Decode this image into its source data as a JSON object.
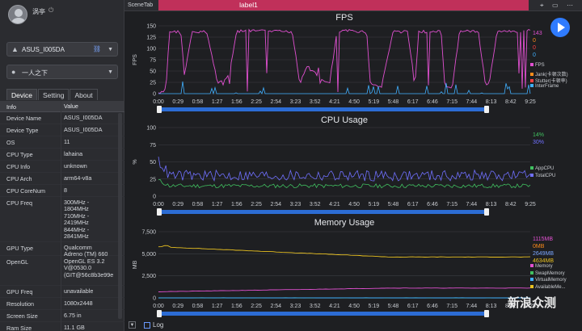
{
  "user": {
    "name": "涡亭"
  },
  "device_select": {
    "label": "ASUS_I005DA"
  },
  "app_select": {
    "label": "一人之下"
  },
  "tabs": [
    "Device",
    "Setting",
    "About"
  ],
  "table": {
    "headers": [
      "Info",
      "Value"
    ],
    "rows": [
      [
        "Device Name",
        "ASUS_I005DA"
      ],
      [
        "Device Type",
        "ASUS_I005DA"
      ],
      [
        "OS",
        "11"
      ],
      [
        "CPU Type",
        "lahaina"
      ],
      [
        "CPU Info",
        "unknown"
      ],
      [
        "CPU Arch",
        "arm64-v8a"
      ],
      [
        "CPU CoreNum",
        "8"
      ],
      [
        "CPU Freq",
        "300MHz -\n1804MHz\n710MHz -\n2419MHz\n844MHz -\n2841MHz"
      ],
      [
        "GPU Type",
        "Qualcomm\nAdreno (TM) 660"
      ],
      [
        "OpenGL",
        "OpenGL ES 3.2\nV@0530.0\n(GIT@56c8b3e99e"
      ],
      [
        "GPU Freq",
        "unavailable"
      ],
      [
        "Resolution",
        "1080x2448"
      ],
      [
        "Screen Size",
        "6.75 in"
      ],
      [
        "Ram Size",
        "11.1 GB"
      ]
    ]
  },
  "topbar": {
    "scene_tab": "SceneTab",
    "label": "label1"
  },
  "bottombar": {
    "log_label": "Log"
  },
  "watermark": "新浪众测",
  "xticks": [
    "0:00",
    "0:29",
    "0:58",
    "1:27",
    "1:56",
    "2:25",
    "2:54",
    "3:23",
    "3:52",
    "4:21",
    "4:50",
    "5:19",
    "5:48",
    "6:17",
    "6:46",
    "7:15",
    "7:44",
    "8:13",
    "8:42",
    "9:25"
  ],
  "chart_data": [
    {
      "type": "line",
      "title": "FPS",
      "ylabel": "FPS",
      "ylim": [
        0,
        150
      ],
      "yticks": [
        "150",
        "125",
        "100",
        "75",
        "50",
        "25",
        "0"
      ],
      "current_values": [
        {
          "text": "143",
          "color": "#e050d0"
        },
        {
          "text": "0",
          "color": "#ff8c1a"
        },
        {
          "text": "0",
          "color": "#ff4040"
        },
        {
          "text": "0",
          "color": "#40b0ff"
        }
      ],
      "series": [
        {
          "name": "FPS",
          "color": "#e050d0"
        },
        {
          "name": "Jank(卡顿次数)",
          "color": "#ff8c1a"
        },
        {
          "name": "Stutter(卡顿率)",
          "color": "#ff4040"
        },
        {
          "name": "InterFrame",
          "color": "#40b0ff"
        }
      ],
      "fps_profile": [
        [
          0,
          2
        ],
        [
          0.02,
          10
        ],
        [
          0.03,
          140
        ],
        [
          0.06,
          140
        ],
        [
          0.07,
          40
        ],
        [
          0.09,
          138
        ],
        [
          0.13,
          140
        ],
        [
          0.16,
          20
        ],
        [
          0.19,
          40
        ],
        [
          0.21,
          140
        ],
        [
          0.23,
          142
        ],
        [
          0.36,
          140
        ],
        [
          0.38,
          20
        ],
        [
          0.4,
          60
        ],
        [
          0.43,
          40
        ],
        [
          0.46,
          20
        ],
        [
          0.48,
          140
        ],
        [
          0.51,
          142
        ],
        [
          0.56,
          140
        ],
        [
          0.57,
          20
        ],
        [
          0.6,
          15
        ],
        [
          0.63,
          140
        ],
        [
          0.67,
          140
        ],
        [
          0.69,
          20
        ],
        [
          0.7,
          140
        ],
        [
          0.76,
          140
        ],
        [
          0.77,
          20
        ],
        [
          0.79,
          15
        ],
        [
          0.81,
          142
        ],
        [
          0.86,
          140
        ],
        [
          0.88,
          20
        ],
        [
          0.89,
          20
        ],
        [
          0.91,
          140
        ],
        [
          0.96,
          140
        ],
        [
          1,
          143
        ]
      ]
    },
    {
      "type": "line",
      "title": "CPU Usage",
      "ylabel": "%",
      "ylim": [
        0,
        100
      ],
      "yticks": [
        "100",
        "75",
        "50",
        "25",
        "0"
      ],
      "current_values": [
        {
          "text": "14%",
          "color": "#40c060"
        },
        {
          "text": "30%",
          "color": "#7070ff"
        }
      ],
      "series": [
        {
          "name": "AppCPU",
          "color": "#40c060",
          "base": 15
        },
        {
          "name": "TotalCPU",
          "color": "#7070ff",
          "base": 30
        }
      ]
    },
    {
      "type": "line",
      "title": "Memory Usage",
      "ylabel": "MB",
      "ylim": [
        0,
        7500
      ],
      "yticks": [
        "7,500",
        "5,000",
        "2,500",
        "0"
      ],
      "current_values": [
        {
          "text": "1115MB",
          "color": "#e050d0"
        },
        {
          "text": "0MB",
          "color": "#ff8c1a"
        },
        {
          "text": "2649MB",
          "color": "#7aa6ff"
        },
        {
          "text": "4634MB",
          "color": "#e8c020"
        }
      ],
      "series": [
        {
          "name": "Memory",
          "color": "#e050d0",
          "start": 700,
          "end": 1115
        },
        {
          "name": "SwapMemory",
          "color": "#40c060",
          "start": 0,
          "end": 0
        },
        {
          "name": "VirtualMemory",
          "color": "#40b0ff",
          "start": 0,
          "end": 0
        },
        {
          "name": "AvailableMe...",
          "color": "#e8c020",
          "start": 5800,
          "end": 4634
        }
      ]
    }
  ]
}
